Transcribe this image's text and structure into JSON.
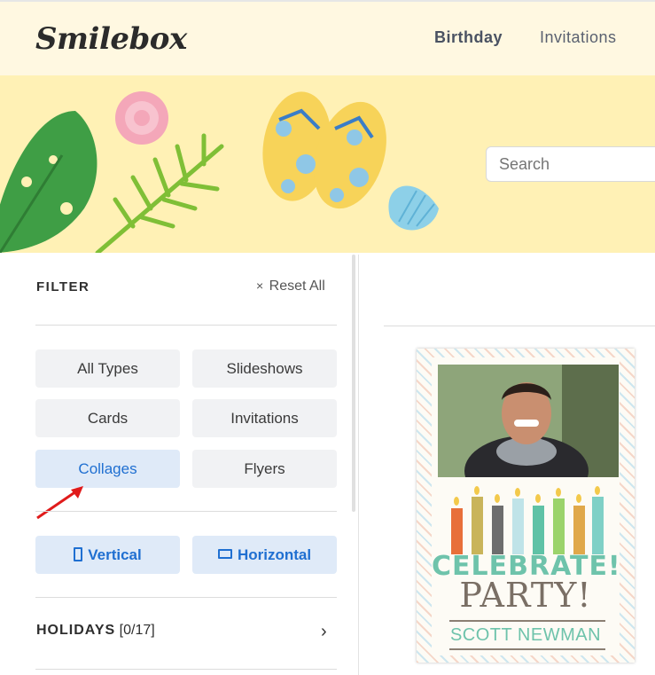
{
  "header": {
    "logo": "Smilebox",
    "nav": [
      "Birthday",
      "Invitations"
    ]
  },
  "search": {
    "placeholder": "Search"
  },
  "filter": {
    "title": "FILTER",
    "reset_label": "Reset All",
    "types": [
      "All Types",
      "Slideshows",
      "Cards",
      "Invitations",
      "Collages",
      "Flyers"
    ],
    "selected_type": "Collages",
    "orientations": [
      "Vertical",
      "Horizontal"
    ],
    "holidays_label": "HOLIDAYS",
    "holidays_count": "[0/17]"
  },
  "card": {
    "line1": "CELEBRATE!",
    "line2": "PARTY!",
    "name": "SCOTT NEWMAN"
  },
  "colors": {
    "header_bg": "#fff8e1",
    "banner_bg": "#fff1b5",
    "accent_blue": "#1f6fd1",
    "chip_active_bg": "#dfeaf8",
    "annotation_arrow": "#e01b1b"
  }
}
